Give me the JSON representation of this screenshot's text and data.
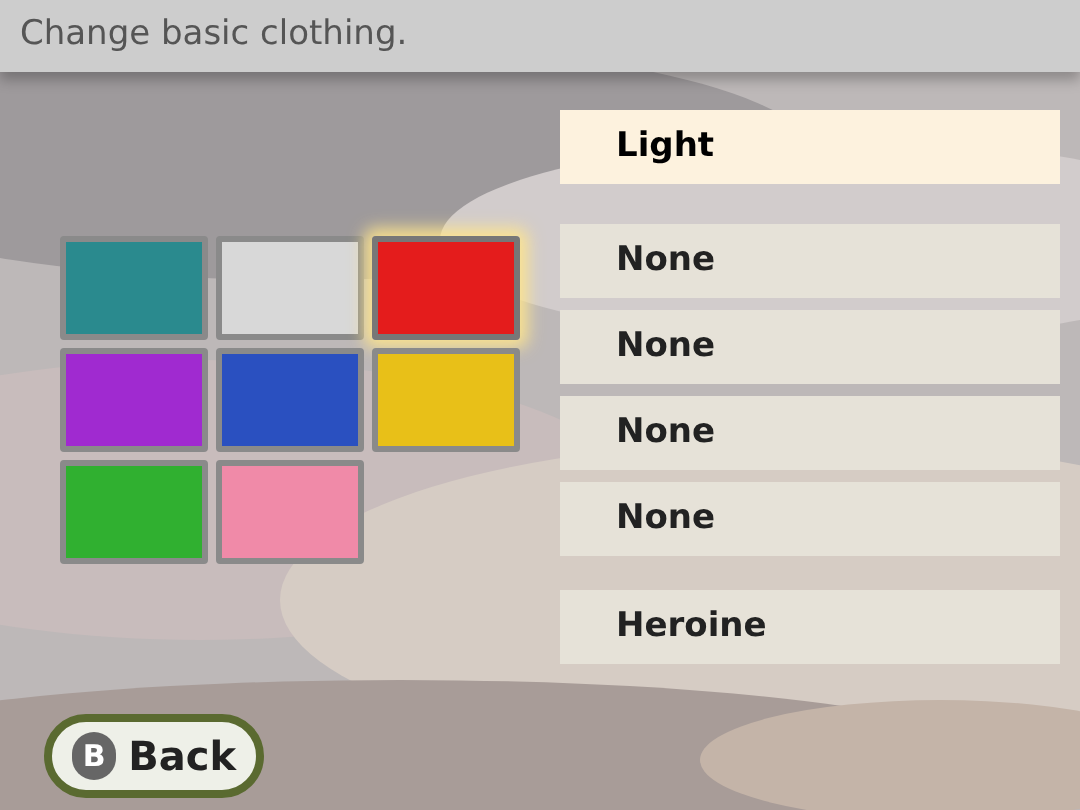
{
  "header": {
    "title": "Change basic clothing."
  },
  "swatches": [
    {
      "color": "#2a8a8e",
      "selected": false
    },
    {
      "color": "#d8d8d8",
      "selected": false
    },
    {
      "color": "#e41c1c",
      "selected": true
    },
    {
      "color": "#a02ad0",
      "selected": false
    },
    {
      "color": "#2a50c0",
      "selected": false
    },
    {
      "color": "#e8c018",
      "selected": false
    },
    {
      "color": "#30b030",
      "selected": false
    },
    {
      "color": "#f08aa8",
      "selected": false
    }
  ],
  "options": [
    {
      "label": "Light",
      "selected": true
    },
    {
      "label": "None",
      "selected": false
    },
    {
      "label": "None",
      "selected": false
    },
    {
      "label": "None",
      "selected": false
    },
    {
      "label": "None",
      "selected": false
    },
    {
      "label": "Heroine",
      "selected": false
    }
  ],
  "back_button": {
    "glyph": "B",
    "label": "Back"
  }
}
